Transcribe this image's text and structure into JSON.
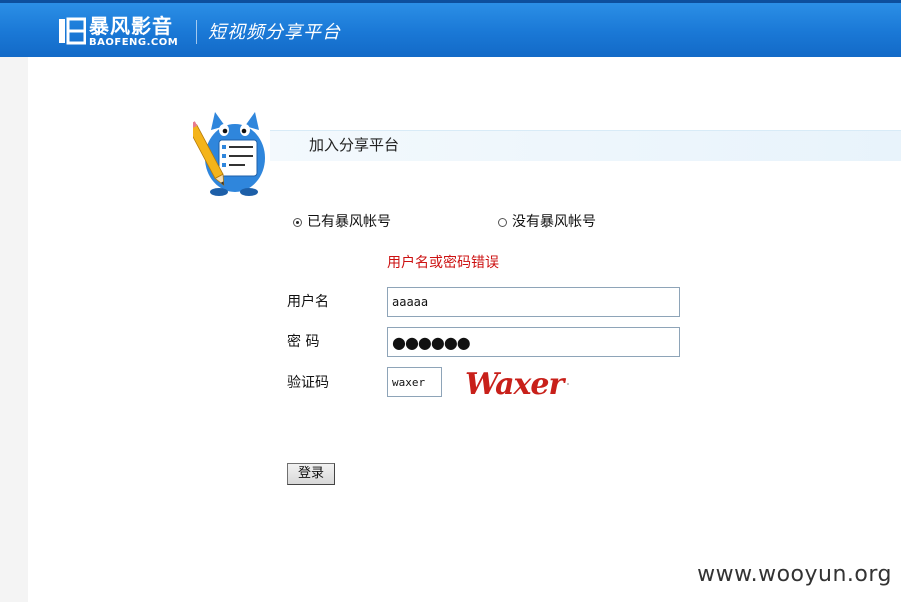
{
  "header": {
    "logo_cn": "暴风影音",
    "logo_en": "BAOFENG.COM",
    "tagline": "短视频分享平台"
  },
  "form": {
    "title": "加入分享平台",
    "account_options": [
      {
        "label": "已有暴风帐号",
        "checked": true
      },
      {
        "label": "没有暴风帐号",
        "checked": false
      }
    ],
    "error_message": "用户名或密码错误",
    "username_label": "用户名",
    "username_value": "aaaaa",
    "password_label": "密 码",
    "password_value": "●●●●●●",
    "captcha_label": "验证码",
    "captcha_value": "waxer",
    "captcha_image_text": "Waxer",
    "submit_label": "登录"
  },
  "watermark": "www.wooyun.org",
  "colors": {
    "header_blue": "#1a78d6",
    "error_red": "#cc1111",
    "captcha_red": "#c8201a",
    "mascot_blue": "#2f86dc"
  }
}
